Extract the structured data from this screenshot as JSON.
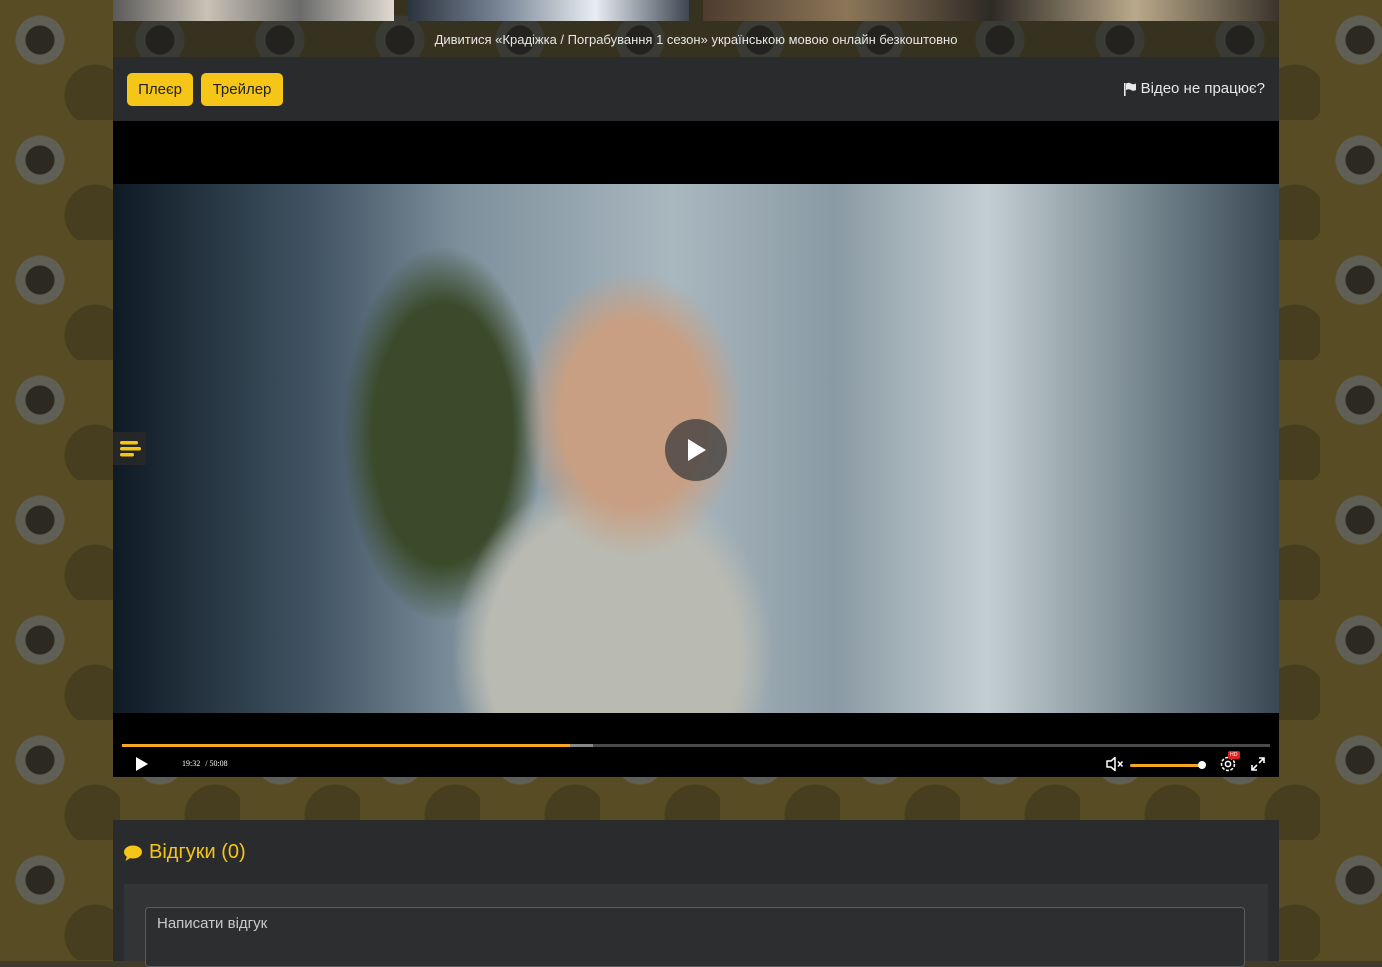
{
  "page": {
    "watch_title": "Дивитися «Крадіжка / Пограбування 1 сезон» українською мовою онлайн безкоштовно"
  },
  "player": {
    "tabs": [
      {
        "label": "Плеєр"
      },
      {
        "label": "Трейлер"
      }
    ],
    "report_label": "Відео не працює?",
    "current_time": "19:32",
    "duration": "/ 50:08",
    "progress_fraction": 0.39,
    "buffered_fraction": 0.41,
    "volume_fraction": 1.0,
    "quality_badge": "HD",
    "icons": {
      "report": "flag-icon",
      "center_play": "play-icon",
      "side_menu": "menu-lines-icon",
      "control_play": "play-icon",
      "mute": "volume-muted-icon",
      "settings": "gear-icon",
      "fullscreen": "expand-icon"
    }
  },
  "comments": {
    "heading": "Відгуки (0)",
    "heading_icon": "comment-bubble-icon",
    "placeholder": "Написати відгук"
  },
  "colors": {
    "accent": "#f5c518",
    "progress": "#f5a623",
    "panel": "#2a2b2d"
  }
}
